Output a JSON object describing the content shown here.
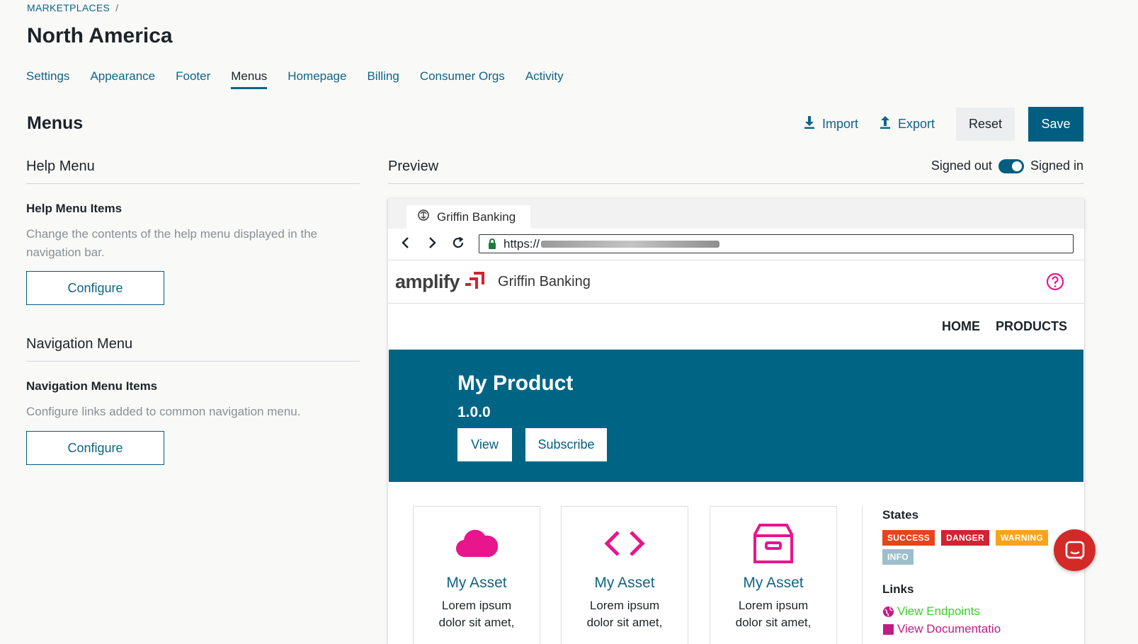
{
  "breadcrumb": {
    "root": "MARKETPLACES",
    "separator": "/"
  },
  "page_title": "North America",
  "tabs": [
    {
      "label": "Settings",
      "active": false
    },
    {
      "label": "Appearance",
      "active": false
    },
    {
      "label": "Footer",
      "active": false
    },
    {
      "label": "Menus",
      "active": true
    },
    {
      "label": "Homepage",
      "active": false
    },
    {
      "label": "Billing",
      "active": false
    },
    {
      "label": "Consumer Orgs",
      "active": false
    },
    {
      "label": "Activity",
      "active": false
    }
  ],
  "section_title": "Menus",
  "toolbar": {
    "import_label": "Import",
    "export_label": "Export",
    "reset_label": "Reset",
    "save_label": "Save"
  },
  "help_menu": {
    "heading": "Help Menu",
    "items_title": "Help Menu Items",
    "description": "Change the contents of the help menu displayed in the navigation bar.",
    "button_label": "Configure"
  },
  "navigation_menu": {
    "heading": "Navigation Menu",
    "items_title": "Navigation Menu Items",
    "description": "Configure links added to common navigation menu.",
    "button_label": "Configure"
  },
  "preview": {
    "heading": "Preview",
    "signed_out_label": "Signed out",
    "signed_in_label": "Signed in",
    "toggle_on": true,
    "browser_tab_title": "Griffin Banking",
    "url_prefix": "https://",
    "site": {
      "logo_text": "amplify",
      "name": "Griffin Banking",
      "nav": [
        "HOME",
        "PRODUCTS"
      ]
    },
    "hero": {
      "title": "My Product",
      "version": "1.0.0",
      "view_label": "View",
      "subscribe_label": "Subscribe"
    },
    "cards": [
      {
        "icon": "cloud-icon",
        "title": "My Asset",
        "text_line1": "Lorem ipsum",
        "text_line2": "dolor sit amet,"
      },
      {
        "icon": "code-icon",
        "title": "My Asset",
        "text_line1": "Lorem ipsum",
        "text_line2": "dolor sit amet,"
      },
      {
        "icon": "archive-icon",
        "title": "My Asset",
        "text_line1": "Lorem ipsum",
        "text_line2": "dolor sit amet,"
      }
    ],
    "states_title": "States",
    "states": [
      {
        "label": "SUCCESS",
        "color": "#e8431c"
      },
      {
        "label": "DANGER",
        "color": "#d12331"
      },
      {
        "label": "WARNING",
        "color": "#f7a31c"
      },
      {
        "label": "INFO",
        "color": "#9cbfcb"
      }
    ],
    "links_title": "Links",
    "link_1": "View Endpoints",
    "link_2": "View Documentatio"
  },
  "colors": {
    "primary": "#005e80",
    "accent_pink": "#e8158c",
    "hero_bg": "#006585",
    "chat_red": "#d32a28"
  }
}
